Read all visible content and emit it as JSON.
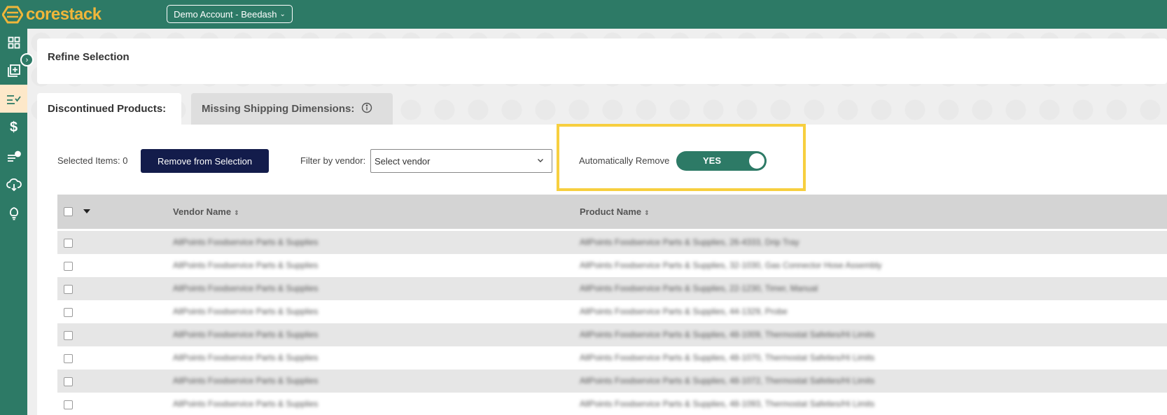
{
  "app": {
    "logo_text": "corestack",
    "account_label": "Demo Account - Beedash"
  },
  "sidebar": {
    "items": [
      {
        "name": "dashboard",
        "icon": "grid-icon"
      },
      {
        "name": "add",
        "icon": "add-stack-icon"
      },
      {
        "name": "refine",
        "icon": "list-check-icon",
        "active": true
      },
      {
        "name": "pricing",
        "icon": "dollar-icon"
      },
      {
        "name": "tasks",
        "icon": "list-badge-icon"
      },
      {
        "name": "download",
        "icon": "cloud-download-icon"
      },
      {
        "name": "ideas",
        "icon": "lightbulb-icon"
      }
    ]
  },
  "refine": {
    "title": "Refine Selection"
  },
  "tabs": [
    {
      "label": "Discontinued Products:"
    },
    {
      "label": "Missing Shipping Dimensions:"
    }
  ],
  "toolbar": {
    "selected_label": "Selected Items: 0",
    "remove_button": "Remove from Selection",
    "filter_label": "Filter by vendor:",
    "vendor_placeholder": "Select vendor",
    "auto_remove_label": "Automatically Remove",
    "auto_remove_value": "YES"
  },
  "table": {
    "columns": [
      "Vendor Name",
      "Product Name"
    ],
    "rows": [
      {
        "vendor": "AllPoints Foodservice Parts & Supplies",
        "product": "AllPoints Foodservice Parts & Supplies, 26-4333, Drip Tray"
      },
      {
        "vendor": "AllPoints Foodservice Parts & Supplies",
        "product": "AllPoints Foodservice Parts & Supplies, 32-1030, Gas Connector Hose Assembly"
      },
      {
        "vendor": "AllPoints Foodservice Parts & Supplies",
        "product": "AllPoints Foodservice Parts & Supplies, 22-1230, Timer, Manual"
      },
      {
        "vendor": "AllPoints Foodservice Parts & Supplies",
        "product": "AllPoints Foodservice Parts & Supplies, 44-1329, Probe"
      },
      {
        "vendor": "AllPoints Foodservice Parts & Supplies",
        "product": "AllPoints Foodservice Parts & Supplies, 48-1009, Thermostat Safeties/Hi Limits"
      },
      {
        "vendor": "AllPoints Foodservice Parts & Supplies",
        "product": "AllPoints Foodservice Parts & Supplies, 48-1070, Thermostat Safeties/Hi Limits"
      },
      {
        "vendor": "AllPoints Foodservice Parts & Supplies",
        "product": "AllPoints Foodservice Parts & Supplies, 48-1072, Thermostat Safeties/Hi Limits"
      },
      {
        "vendor": "AllPoints Foodservice Parts & Supplies",
        "product": "AllPoints Foodservice Parts & Supplies, 48-1093, Thermostat Safeties/Hi Limits"
      }
    ]
  },
  "colors": {
    "brand": "#2d7a66",
    "logo": "#f0b63a",
    "button": "#131c4b",
    "highlight": "#f7cf3f"
  }
}
